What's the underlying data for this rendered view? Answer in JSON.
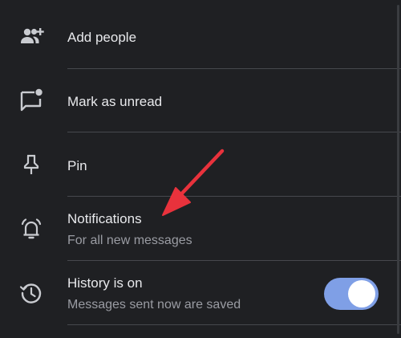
{
  "menu": {
    "items": [
      {
        "label": "Add people",
        "icon": "add-people-icon"
      },
      {
        "label": "Mark as unread",
        "icon": "mark-unread-icon"
      },
      {
        "label": "Pin",
        "icon": "pin-icon"
      },
      {
        "label": "Notifications",
        "sublabel": "For all new messages",
        "icon": "bell-icon"
      },
      {
        "label": "History is on",
        "sublabel": "Messages sent now are saved",
        "icon": "history-icon",
        "toggle": true
      }
    ]
  },
  "colors": {
    "background": "#1f2023",
    "toggle_track": "#7f9fe6",
    "annotation_arrow": "#e8323c"
  },
  "annotation": {
    "icon": "red-arrow-icon"
  }
}
